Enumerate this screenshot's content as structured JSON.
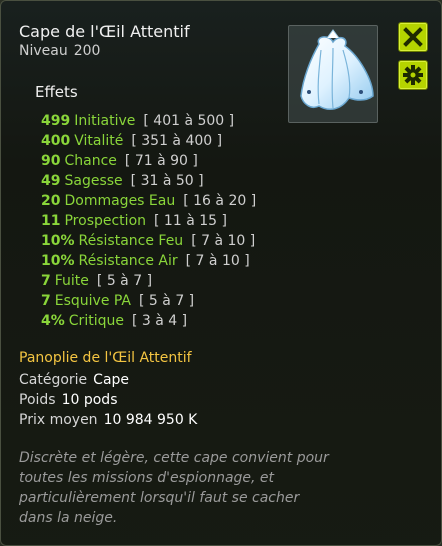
{
  "item": {
    "name": "Cape de l'Œil Attentif",
    "level_label": "Niveau",
    "level_value": "200"
  },
  "effects": {
    "title": "Effets",
    "list": [
      {
        "value": "499",
        "name": "Initiative",
        "range": "[ 401 à 500 ]"
      },
      {
        "value": "400",
        "name": "Vitalité",
        "range": "[ 351 à 400 ]"
      },
      {
        "value": "90",
        "name": "Chance",
        "range": "[ 71 à 90 ]"
      },
      {
        "value": "49",
        "name": "Sagesse",
        "range": "[ 31 à 50 ]"
      },
      {
        "value": "20",
        "name": "Dommages Eau",
        "range": "[ 16 à 20 ]"
      },
      {
        "value": "11",
        "name": "Prospection",
        "range": "[ 11 à 15 ]"
      },
      {
        "value": "10%",
        "name": "Résistance Feu",
        "range": "[ 7 à 10 ]"
      },
      {
        "value": "10%",
        "name": "Résistance Air",
        "range": "[ 7 à 10 ]"
      },
      {
        "value": "7",
        "name": "Fuite",
        "range": "[ 5 à 7 ]"
      },
      {
        "value": "7",
        "name": "Esquive PA",
        "range": "[ 5 à 7 ]"
      },
      {
        "value": "4%",
        "name": "Critique",
        "range": "[ 3 à 4 ]"
      }
    ]
  },
  "set": {
    "name": "Panoplie de l'Œil Attentif"
  },
  "properties": {
    "category_label": "Catégorie",
    "category_value": "Cape",
    "weight_label": "Poids",
    "weight_value": "10 pods",
    "price_label": "Prix moyen",
    "price_value": "10 984 950 K"
  },
  "description": {
    "lines": [
      "Discrète et légère, cette cape convient pour",
      "toutes les missions d'espionnage, et",
      "particulièrement lorsqu'il faut se cacher",
      "dans la neige."
    ]
  },
  "icons": {
    "close": "close-icon",
    "settings": "gear-icon",
    "item": "cape-icon"
  },
  "colors": {
    "effect_green": "#8ad63a",
    "set_gold": "#f4c542",
    "button_lime": "#b5d400"
  }
}
